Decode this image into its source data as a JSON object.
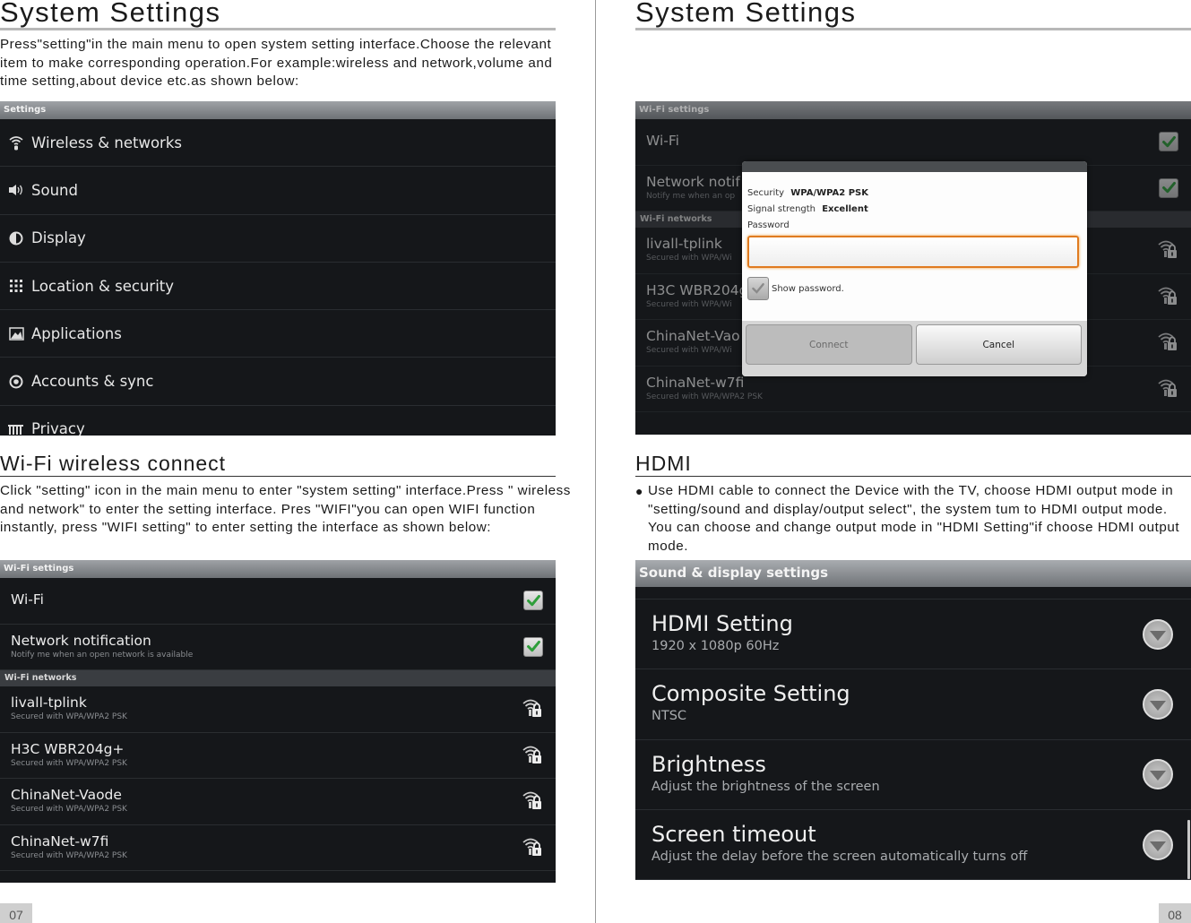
{
  "left_page": {
    "title": "System Settings",
    "intro": "Press\"setting\"in the main menu to open system setting interface.Choose the relevant item to make corresponding operation.For example:wireless and network,volume and time setting,about device etc.as shown below:",
    "settings_screen": {
      "header": "Settings",
      "items": [
        {
          "icon": "wifi-icon",
          "label": "Wireless & networks"
        },
        {
          "icon": "speaker-icon",
          "label": "Sound"
        },
        {
          "icon": "display-icon",
          "label": "Display"
        },
        {
          "icon": "location-grid-icon",
          "label": "Location & security"
        },
        {
          "icon": "applications-icon",
          "label": "Applications"
        },
        {
          "icon": "sync-icon",
          "label": "Accounts & sync"
        },
        {
          "icon": "privacy-icon",
          "label": "Privacy"
        }
      ]
    },
    "wifi_section": {
      "heading": "Wi-Fi wireless connect",
      "body": "Click \"setting\" icon in the main menu to enter \"system setting\" interface.Press \" wireless and network\" to enter the setting interface. Pres \"WIFI\"you can open WIFI function instantly, press \"WIFI setting\" to enter setting the interface as shown below:"
    },
    "wifi_screen": {
      "header": "Wi-Fi settings",
      "wifi_toggle": {
        "label": "Wi-Fi",
        "checked": true
      },
      "notification": {
        "label": "Network notification",
        "sublabel": "Notify me when an open network is available",
        "checked": true
      },
      "networks_header": "Wi-Fi networks",
      "networks": [
        {
          "name": "livall-tplink",
          "security": "Secured with WPA/WPA2 PSK"
        },
        {
          "name": "H3C WBR204g+",
          "security": "Secured with WPA/WPA2 PSK"
        },
        {
          "name": "ChinaNet-Vaode",
          "security": "Secured with WPA/WPA2 PSK"
        },
        {
          "name": "ChinaNet-w7fi",
          "security": "Secured with WPA/WPA2 PSK"
        }
      ]
    },
    "page_number": "07"
  },
  "right_page": {
    "title": "System Settings",
    "wifi_dialog_screen": {
      "header": "Wi-Fi settings",
      "wifi_label": "Wi-Fi",
      "notification_label": "Network notif",
      "notification_sub": "Notify me when an op",
      "networks_header": "Wi-Fi networks",
      "networks": [
        {
          "name": "livall-tplink",
          "security": "Secured with WPA/Wi"
        },
        {
          "name": "H3C WBR204g",
          "security": "Secured with WPA/Wi"
        },
        {
          "name": "ChinaNet-Vao",
          "security": "Secured with WPA/Wi"
        },
        {
          "name": "ChinaNet-w7fi",
          "security": "Secured with WPA/WPA2 PSK"
        }
      ],
      "dialog": {
        "security_label": "Security",
        "security_value": "WPA/WPA2 PSK",
        "signal_label": "Signal strength",
        "signal_value": "Excellent",
        "password_label": "Password",
        "password_value": "",
        "show_password_label": "Show password.",
        "show_password_checked": true,
        "connect_label": "Connect",
        "cancel_label": "Cancel"
      }
    },
    "hdmi_section": {
      "heading": "HDMI",
      "bullet": "●",
      "body": "Use HDMI cable to connect the Device with the TV, choose HDMI output mode in \"setting/sound and display/output select\", the system tum to HDMI output mode. You can choose and change output mode in \"HDMI Setting\"if choose HDMI output mode."
    },
    "sound_display_screen": {
      "header": "Sound & display settings",
      "items": [
        {
          "title": "HDMI Setting",
          "summary": "1920 x 1080p 60Hz"
        },
        {
          "title": "Composite Setting",
          "summary": "NTSC"
        },
        {
          "title": "Brightness",
          "summary": "Adjust the brightness of the screen"
        },
        {
          "title": "Screen timeout",
          "summary": "Adjust the delay before the screen automatically turns off"
        }
      ]
    },
    "page_number": "08"
  },
  "colors": {
    "android_bg": "#15171a",
    "checkbox_green": "#2e9e3a",
    "input_focus_orange": "#e07b20",
    "rule_gray": "#b8b8b8"
  }
}
